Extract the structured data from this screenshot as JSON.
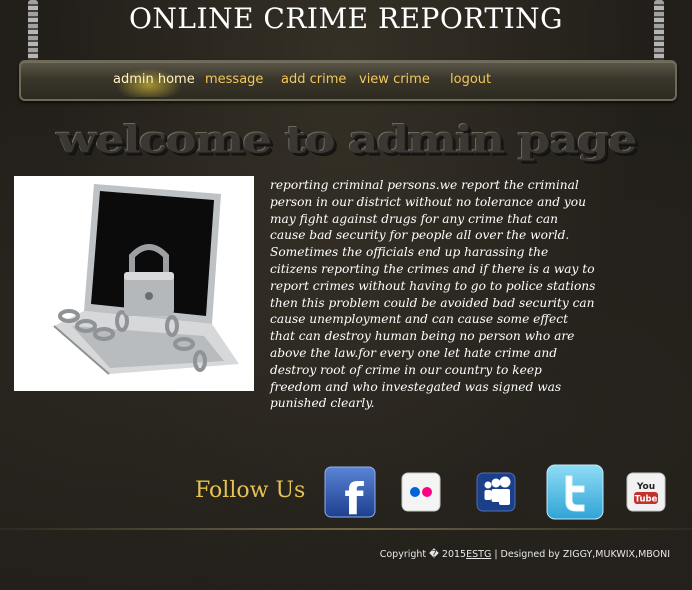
{
  "site": {
    "title": "ONLINE CRIME REPORTING"
  },
  "nav": {
    "items": [
      {
        "label": "admin home"
      },
      {
        "label": "message"
      },
      {
        "label": "add crime"
      },
      {
        "label": "view crime"
      },
      {
        "label": "logout"
      }
    ]
  },
  "welcome": {
    "heading": "welcome to admin page"
  },
  "content": {
    "image_alt": "laptop locked with chain and padlock",
    "text": "reporting criminal persons.we report the criminal person in our district without no tolerance and you may fight against drugs for any crime that can cause bad security for people all over the world. Sometimes the officials end up harassing the citizens reporting the crimes and if there is a way to report crimes without having to go to police stations then this problem could be avoided bad security can cause unemployment and can cause some effect that can destroy human being no person who are above the law.for every one let hate crime and destroy root of crime in our country to keep freedom and who investegated was signed was punished clearly."
  },
  "social": {
    "label": "Follow Us",
    "icons": [
      {
        "name": "facebook-icon",
        "glyph": "f",
        "color": "#2a56b0"
      },
      {
        "name": "flickr-icon",
        "color": "#e8e8e8"
      },
      {
        "name": "myspace-icon",
        "color": "#1c3f8a"
      },
      {
        "name": "twitter-icon",
        "color": "#3fb4e0"
      },
      {
        "name": "youtube-icon",
        "glyph": "You Tube",
        "color": "#c4302b"
      }
    ]
  },
  "footer": {
    "prefix": "Copyright � 2015",
    "link": "ESTG",
    "suffix": " | Designed by ZIGGY,MUKWIX,MBONI"
  }
}
